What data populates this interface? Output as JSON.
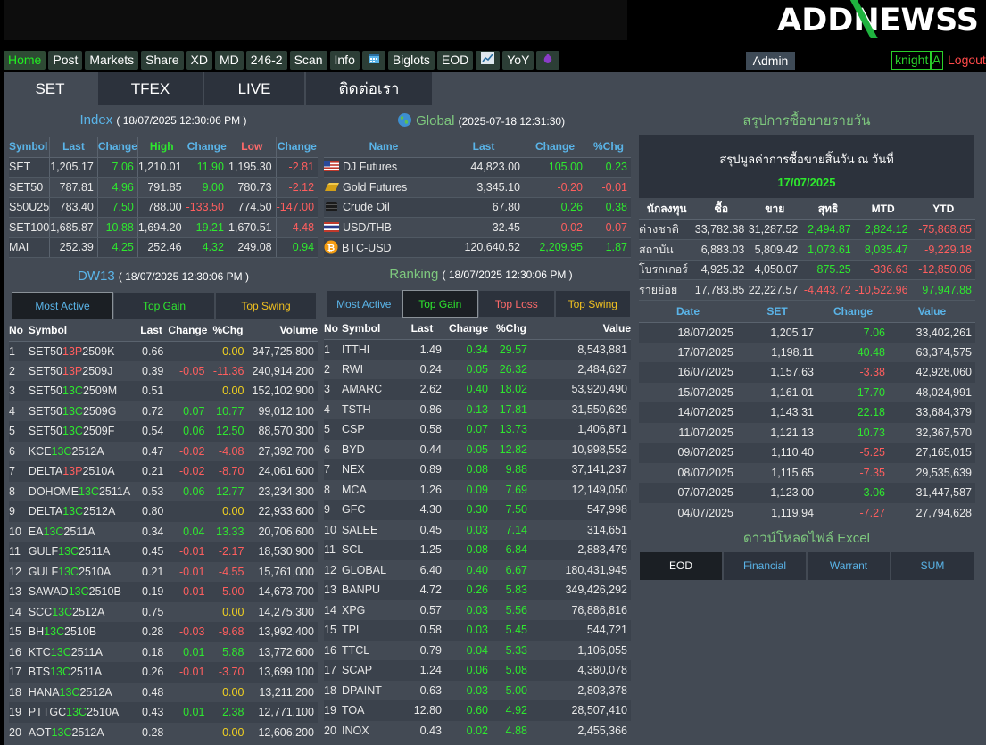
{
  "brand": {
    "logo": "ADDNewss"
  },
  "nav": {
    "items": [
      "Home",
      "Post",
      "Markets",
      "Share",
      "XD",
      "MD",
      "246-2",
      "Scan",
      "Info",
      "",
      "Biglots",
      "EOD",
      "",
      "YoY",
      ""
    ],
    "admin": "Admin",
    "user": "knight",
    "user_badge": "A",
    "logout": "Logout"
  },
  "tabs": [
    "SET",
    "TFEX",
    "LIVE",
    "ติดต่อเรา"
  ],
  "index": {
    "title": "Index",
    "timestamp": "( 18/07/2025 12:30:06 PM )",
    "headers": [
      "Symbol",
      "Last",
      "Change",
      "High",
      "Change",
      "Low",
      "Change"
    ],
    "rows": [
      [
        "SET",
        "1,205.17",
        "7.06",
        "1,210.01",
        "11.90",
        "1,195.30",
        "-2.81"
      ],
      [
        "SET50",
        "787.81",
        "4.96",
        "791.85",
        "9.00",
        "780.73",
        "-2.12"
      ],
      [
        "S50U25",
        "783.40",
        "7.50",
        "788.00",
        "-133.50",
        "774.50",
        "-147.00"
      ],
      [
        "SET100",
        "1,685.87",
        "10.88",
        "1,694.20",
        "19.21",
        "1,670.51",
        "-4.48"
      ],
      [
        "MAI",
        "252.39",
        "4.25",
        "252.46",
        "4.32",
        "249.08",
        "0.94"
      ]
    ]
  },
  "global": {
    "title": "Global",
    "timestamp": "(2025-07-18 12:31:30)",
    "headers": [
      "Name",
      "Last",
      "Change",
      "%Chg"
    ],
    "rows": [
      [
        "DJ Futures",
        "44,823.00",
        "105.00",
        "0.23",
        "us-flag-icon"
      ],
      [
        "Gold Futures",
        "3,345.10",
        "-0.20",
        "-0.01",
        "gold-bar-icon"
      ],
      [
        "Crude Oil",
        "67.80",
        "0.26",
        "0.38",
        "oil-barrel-icon"
      ],
      [
        "USD/THB",
        "32.45",
        "-0.02",
        "-0.07",
        "th-flag-icon"
      ],
      [
        "BTC-USD",
        "120,640.52",
        "2,209.95",
        "1.87",
        "bitcoin-icon"
      ]
    ]
  },
  "dw": {
    "title": "DW13",
    "timestamp": "( 18/07/2025 12:30:06 PM )",
    "tabs": [
      "Most Active",
      "Top Gain",
      "Top Swing"
    ],
    "headers": [
      "No",
      "Symbol",
      "Last",
      "Change",
      "%Chg",
      "Volume"
    ],
    "rows": [
      [
        "1",
        "SET50",
        "13P",
        "2509K",
        "0.66",
        "",
        "0.00",
        "347,725,800"
      ],
      [
        "2",
        "SET50",
        "13P",
        "2509J",
        "0.39",
        "-0.05",
        "-11.36",
        "240,914,200"
      ],
      [
        "3",
        "SET50",
        "13C",
        "2509M",
        "0.51",
        "",
        "0.00",
        "152,102,900"
      ],
      [
        "4",
        "SET50",
        "13C",
        "2509G",
        "0.72",
        "0.07",
        "10.77",
        "99,012,100"
      ],
      [
        "5",
        "SET50",
        "13C",
        "2509F",
        "0.54",
        "0.06",
        "12.50",
        "88,570,300"
      ],
      [
        "6",
        "KCE",
        "13C",
        "2512A",
        "0.47",
        "-0.02",
        "-4.08",
        "27,392,700"
      ],
      [
        "7",
        "DELTA",
        "13P",
        "2510A",
        "0.21",
        "-0.02",
        "-8.70",
        "24,061,600"
      ],
      [
        "8",
        "DOHOME",
        "13C",
        "2511A",
        "0.53",
        "0.06",
        "12.77",
        "23,234,300"
      ],
      [
        "9",
        "DELTA",
        "13C",
        "2512A",
        "0.80",
        "",
        "0.00",
        "22,933,600"
      ],
      [
        "10",
        "EA",
        "13C",
        "2511A",
        "0.34",
        "0.04",
        "13.33",
        "20,706,600"
      ],
      [
        "11",
        "GULF",
        "13C",
        "2511A",
        "0.45",
        "-0.01",
        "-2.17",
        "18,530,900"
      ],
      [
        "12",
        "GULF",
        "13C",
        "2510A",
        "0.21",
        "-0.01",
        "-4.55",
        "15,761,000"
      ],
      [
        "13",
        "SAWAD",
        "13C",
        "2510B",
        "0.19",
        "-0.01",
        "-5.00",
        "14,673,700"
      ],
      [
        "14",
        "SCC",
        "13C",
        "2512A",
        "0.75",
        "",
        "0.00",
        "14,275,300"
      ],
      [
        "15",
        "BH",
        "13C",
        "2510B",
        "0.28",
        "-0.03",
        "-9.68",
        "13,992,400"
      ],
      [
        "16",
        "KTC",
        "13C",
        "2511A",
        "0.18",
        "0.01",
        "5.88",
        "13,772,600"
      ],
      [
        "17",
        "BTS",
        "13C",
        "2511A",
        "0.26",
        "-0.01",
        "-3.70",
        "13,699,100"
      ],
      [
        "18",
        "HANA",
        "13C",
        "2512A",
        "0.48",
        "",
        "0.00",
        "13,211,200"
      ],
      [
        "19",
        "PTTGC",
        "13C",
        "2510A",
        "0.43",
        "0.01",
        "2.38",
        "12,771,100"
      ],
      [
        "20",
        "AOT",
        "13C",
        "2512A",
        "0.28",
        "",
        "0.00",
        "12,606,200"
      ]
    ]
  },
  "ranking": {
    "title": "Ranking",
    "timestamp": "( 18/07/2025 12:30:06 PM )",
    "tabs": [
      "Most Active",
      "Top Gain",
      "Top Loss",
      "Top Swing"
    ],
    "headers": [
      "No",
      "Symbol",
      "Last",
      "Change",
      "%Chg",
      "Value"
    ],
    "rows": [
      [
        "1",
        "ITTHI",
        "1.49",
        "0.34",
        "29.57",
        "8,543,881"
      ],
      [
        "2",
        "RWI",
        "0.24",
        "0.05",
        "26.32",
        "2,484,627"
      ],
      [
        "3",
        "AMARC",
        "2.62",
        "0.40",
        "18.02",
        "53,920,490"
      ],
      [
        "4",
        "TSTH",
        "0.86",
        "0.13",
        "17.81",
        "31,550,629"
      ],
      [
        "5",
        "CSP",
        "0.58",
        "0.07",
        "13.73",
        "1,406,871"
      ],
      [
        "6",
        "BYD",
        "0.44",
        "0.05",
        "12.82",
        "10,998,552"
      ],
      [
        "7",
        "NEX",
        "0.89",
        "0.08",
        "9.88",
        "37,141,237"
      ],
      [
        "8",
        "MCA",
        "1.26",
        "0.09",
        "7.69",
        "12,149,050"
      ],
      [
        "9",
        "GFC",
        "4.30",
        "0.30",
        "7.50",
        "547,998"
      ],
      [
        "10",
        "SALEE",
        "0.45",
        "0.03",
        "7.14",
        "314,651"
      ],
      [
        "11",
        "SCL",
        "1.25",
        "0.08",
        "6.84",
        "2,883,479"
      ],
      [
        "12",
        "GLOBAL",
        "6.40",
        "0.40",
        "6.67",
        "180,431,945"
      ],
      [
        "13",
        "BANPU",
        "4.72",
        "0.26",
        "5.83",
        "349,426,292"
      ],
      [
        "14",
        "XPG",
        "0.57",
        "0.03",
        "5.56",
        "76,886,816"
      ],
      [
        "15",
        "TPL",
        "0.58",
        "0.03",
        "5.45",
        "544,721"
      ],
      [
        "16",
        "TTCL",
        "0.79",
        "0.04",
        "5.33",
        "1,106,055"
      ],
      [
        "17",
        "SCAP",
        "1.24",
        "0.06",
        "5.08",
        "4,380,078"
      ],
      [
        "18",
        "DPAINT",
        "0.63",
        "0.03",
        "5.00",
        "2,803,378"
      ],
      [
        "19",
        "TOA",
        "12.80",
        "0.60",
        "4.92",
        "28,507,410"
      ],
      [
        "20",
        "INOX",
        "0.43",
        "0.02",
        "4.88",
        "2,455,366"
      ]
    ]
  },
  "summary": {
    "title": "สรุปการซื้อขายรายวัน",
    "box_line1": "สรุปมูลค่าการซื้อขายสิ้นวัน ณ วันที่",
    "box_date": "17/07/2025",
    "headers": [
      "นักลงทุน",
      "ซื้อ",
      "ขาย",
      "สุทธิ",
      "MTD",
      "YTD"
    ],
    "rows": [
      [
        "ต่างชาติ",
        "33,782.38",
        "31,287.52",
        "2,494.87",
        "2,824.12",
        "-75,868.65"
      ],
      [
        "สถาบัน",
        "6,883.03",
        "5,809.42",
        "1,073.61",
        "8,035.47",
        "-9,229.18"
      ],
      [
        "โบรกเกอร์",
        "4,925.32",
        "4,050.07",
        "875.25",
        "-336.63",
        "-12,850.06"
      ],
      [
        "รายย่อย",
        "17,783.85",
        "22,227.57",
        "-4,443.72",
        "-10,522.96",
        "97,947.88"
      ]
    ]
  },
  "history": {
    "headers": [
      "Date",
      "SET",
      "Change",
      "Value"
    ],
    "rows": [
      [
        "18/07/2025",
        "1,205.17",
        "7.06",
        "33,402,261"
      ],
      [
        "17/07/2025",
        "1,198.11",
        "40.48",
        "63,374,575"
      ],
      [
        "16/07/2025",
        "1,157.63",
        "-3.38",
        "42,928,060"
      ],
      [
        "15/07/2025",
        "1,161.01",
        "17.70",
        "48,024,991"
      ],
      [
        "14/07/2025",
        "1,143.31",
        "22.18",
        "33,684,379"
      ],
      [
        "11/07/2025",
        "1,121.13",
        "10.73",
        "32,367,570"
      ],
      [
        "09/07/2025",
        "1,110.40",
        "-5.25",
        "27,165,015"
      ],
      [
        "08/07/2025",
        "1,115.65",
        "-7.35",
        "29,535,639"
      ],
      [
        "07/07/2025",
        "1,123.00",
        "3.06",
        "31,447,587"
      ],
      [
        "04/07/2025",
        "1,119.94",
        "-7.27",
        "27,794,628"
      ]
    ]
  },
  "download": {
    "title": "ดาวน์โหลดไฟล์ Excel",
    "items": [
      "EOD",
      "Financial",
      "Warrant",
      "SUM"
    ]
  }
}
